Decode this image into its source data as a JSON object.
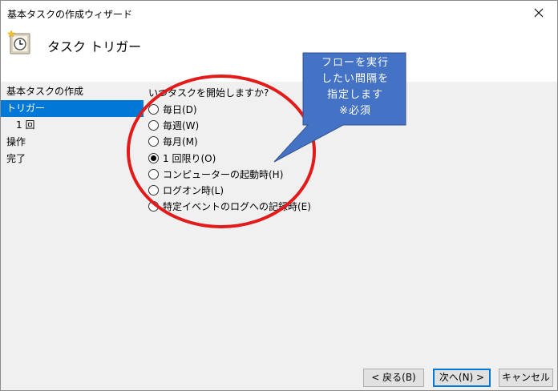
{
  "window": {
    "title": "基本タスクの作成ウィザード"
  },
  "header": {
    "title": "タスク トリガー",
    "icon": "task-scheduler-clock-icon"
  },
  "steps": [
    {
      "label": "基本タスクの作成",
      "active": false,
      "sub": false
    },
    {
      "label": "トリガー",
      "active": true,
      "sub": false
    },
    {
      "label": "1 回",
      "active": false,
      "sub": true
    },
    {
      "label": "操作",
      "active": false,
      "sub": false
    },
    {
      "label": "完了",
      "active": false,
      "sub": false
    }
  ],
  "content": {
    "question": "いつタスクを開始しますか?",
    "options": [
      {
        "label": "毎日(D)",
        "checked": false
      },
      {
        "label": "毎週(W)",
        "checked": false
      },
      {
        "label": "毎月(M)",
        "checked": false
      },
      {
        "label": "1 回限り(O)",
        "checked": true
      },
      {
        "label": "コンピューターの起動時(H)",
        "checked": false
      },
      {
        "label": "ログオン時(L)",
        "checked": false
      },
      {
        "label": "特定イベントのログへの記録時(E)",
        "checked": false
      }
    ]
  },
  "buttons": {
    "back": "< 戻る(B)",
    "next": "次へ(N) >",
    "cancel": "キャンセル"
  },
  "annotation": {
    "lines": [
      "フローを実行",
      "したい間隔を",
      "指定します",
      "※必須"
    ],
    "callout_color": "#4472c4",
    "ellipse_color": "#e31a1a"
  }
}
